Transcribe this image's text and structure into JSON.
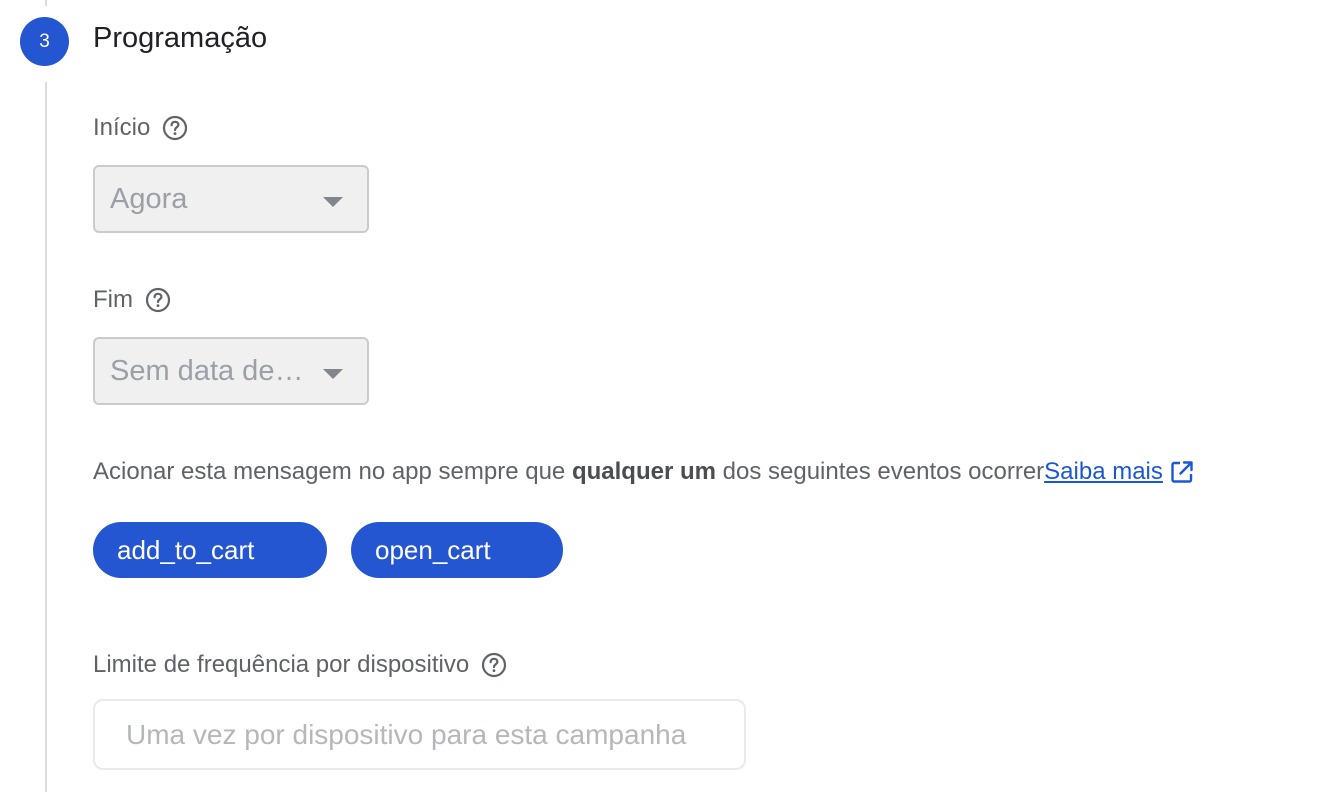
{
  "step": {
    "number": "3",
    "title": "Programação"
  },
  "start": {
    "label": "Início",
    "value": "Agora"
  },
  "end": {
    "label": "Fim",
    "value": "Sem data de…"
  },
  "trigger": {
    "text_before": "Acionar esta mensagem no app sempre que ",
    "text_bold": "qualquer um",
    "text_after": " dos seguintes eventos ocorrer",
    "learn_more": "Saiba mais",
    "events": [
      "add_to_cart",
      "open_cart"
    ]
  },
  "frequency": {
    "label": "Limite de frequência por dispositivo",
    "placeholder": "Uma vez por dispositivo para esta campanha"
  },
  "colors": {
    "accent": "#2556d1",
    "link": "#1a57d6"
  },
  "icons": {
    "help": "help-circle-icon",
    "external": "open-in-new-icon",
    "dropdown": "caret-down-icon"
  }
}
